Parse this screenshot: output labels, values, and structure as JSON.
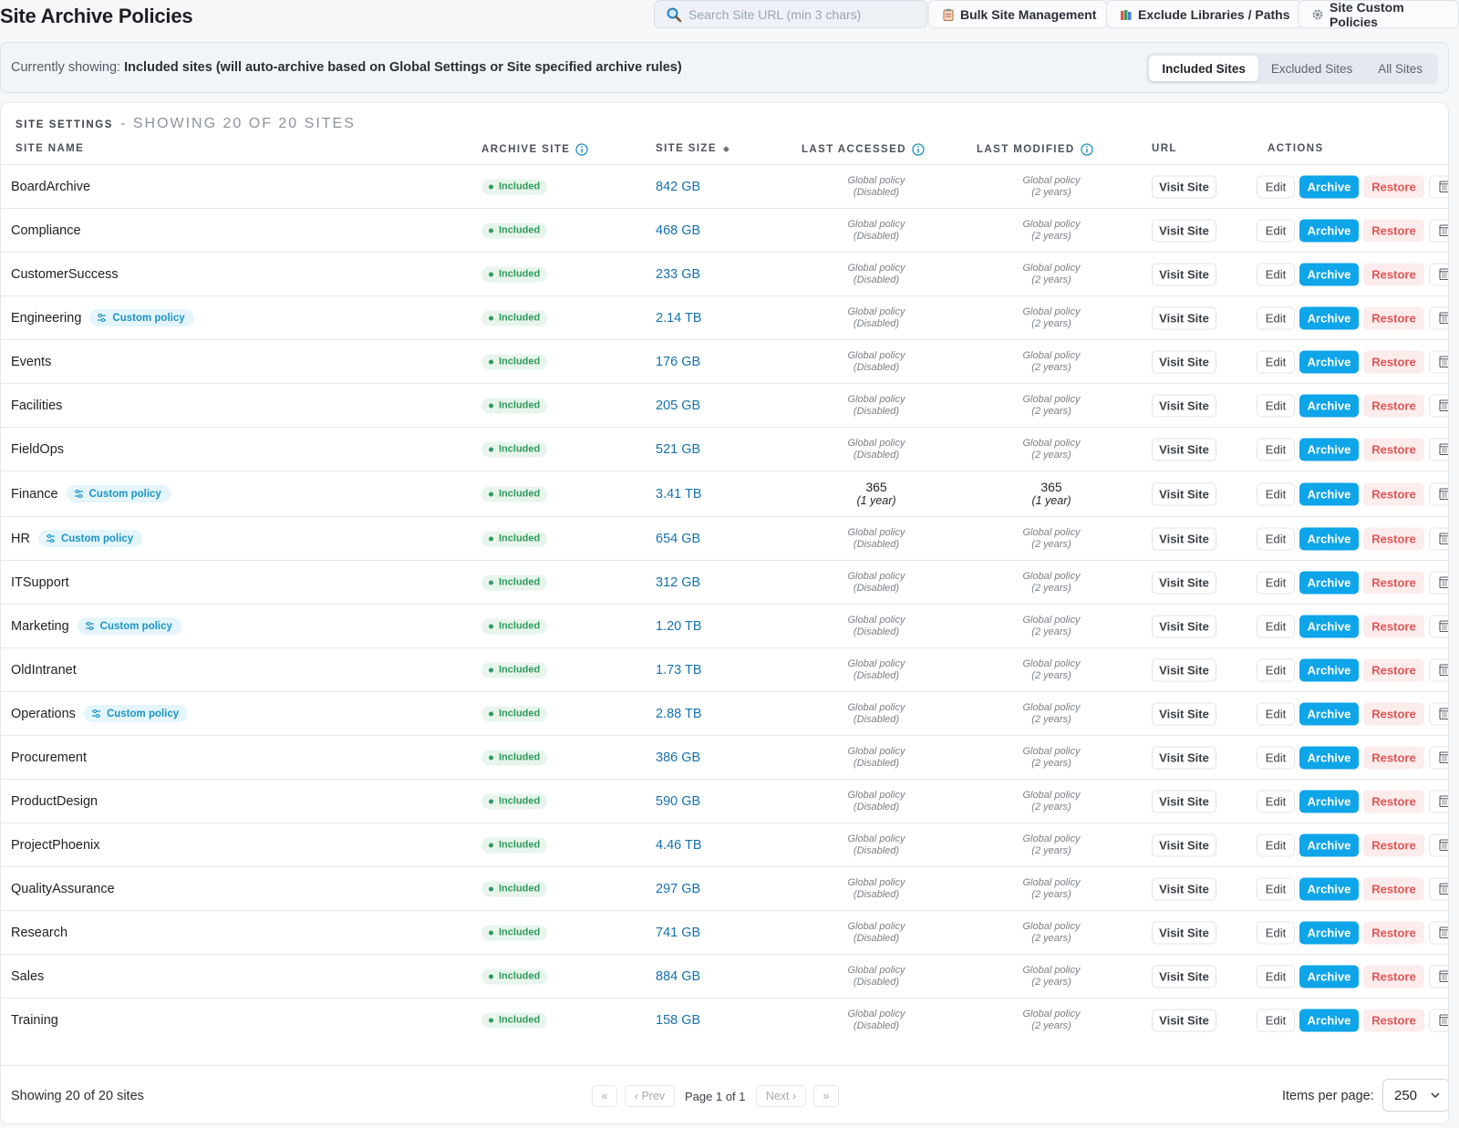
{
  "header": {
    "title": "Site Archive Policies",
    "search_placeholder": "Search Site URL (min 3 chars)",
    "bulk_label": "Bulk Site Management",
    "exclude_label": "Exclude Libraries / Paths",
    "custom_label": "Site Custom Policies"
  },
  "filter": {
    "prefix": "Currently showing:",
    "description": "Included sites (will auto-archive based on Global Settings or Site specified archive rules)",
    "tabs": [
      "Included Sites",
      "Excluded Sites",
      "All Sites"
    ],
    "active_tab": "Included Sites"
  },
  "table": {
    "section_label": "SITE SETTINGS",
    "section_count": "- SHOWING 20 OF 20 SITES",
    "columns": {
      "name": "SITE NAME",
      "archive": "ARCHIVE SITE",
      "size": "SITE SIZE",
      "last_accessed": "LAST ACCESSED",
      "last_modified": "LAST MODIFIED",
      "url": "URL",
      "actions": "ACTIONS"
    },
    "labels": {
      "included": "Included",
      "custom_policy": "Custom policy",
      "visit": "Visit Site",
      "edit": "Edit",
      "archive": "Archive",
      "restore": "Restore",
      "global_policy": "Global policy",
      "disabled": "(Disabled)",
      "two_years": "(2 years)"
    },
    "rows": [
      {
        "name": "BoardArchive",
        "custom": false,
        "size": "842 GB"
      },
      {
        "name": "Compliance",
        "custom": false,
        "size": "468 GB"
      },
      {
        "name": "CustomerSuccess",
        "custom": false,
        "size": "233 GB"
      },
      {
        "name": "Engineering",
        "custom": true,
        "size": "2.14 TB"
      },
      {
        "name": "Events",
        "custom": false,
        "size": "176 GB"
      },
      {
        "name": "Facilities",
        "custom": false,
        "size": "205 GB"
      },
      {
        "name": "FieldOps",
        "custom": false,
        "size": "521 GB"
      },
      {
        "name": "Finance",
        "custom": true,
        "size": "3.41 TB",
        "accessed": {
          "days": "365",
          "note": "(1 year)"
        },
        "modified": {
          "days": "365",
          "note": "(1 year)"
        }
      },
      {
        "name": "HR",
        "custom": true,
        "size": "654 GB"
      },
      {
        "name": "ITSupport",
        "custom": false,
        "size": "312 GB"
      },
      {
        "name": "Marketing",
        "custom": true,
        "size": "1.20 TB"
      },
      {
        "name": "OldIntranet",
        "custom": false,
        "size": "1.73 TB"
      },
      {
        "name": "Operations",
        "custom": true,
        "size": "2.88 TB"
      },
      {
        "name": "Procurement",
        "custom": false,
        "size": "386 GB"
      },
      {
        "name": "ProductDesign",
        "custom": false,
        "size": "590 GB"
      },
      {
        "name": "ProjectPhoenix",
        "custom": false,
        "size": "4.46 TB"
      },
      {
        "name": "QualityAssurance",
        "custom": false,
        "size": "297 GB"
      },
      {
        "name": "Research",
        "custom": false,
        "size": "741 GB"
      },
      {
        "name": "Sales",
        "custom": false,
        "size": "884 GB"
      },
      {
        "name": "Training",
        "custom": false,
        "size": "158 GB"
      }
    ]
  },
  "footer": {
    "showing": "Showing 20 of 20 sites",
    "first": "«",
    "prev": "‹ Prev",
    "page": "Page 1 of 1",
    "next": "Next ›",
    "last": "»",
    "items_label": "Items per page:",
    "items_value": "250"
  },
  "colors": {
    "accent": "#0ea5e9",
    "included_green": "#2f9a5a",
    "custom_blue": "#1b94c6",
    "restore_red": "#e05555",
    "size_link": "#1672ad"
  },
  "icons": {
    "search": "magnifier-icon",
    "bulk": "clipboard-icon",
    "exclude": "books-icon",
    "custom": "gear-icon",
    "info": "info-icon",
    "sort": "sort-diamond-icon",
    "custom_badge": "sliders-icon",
    "more": "calendar-icon"
  }
}
